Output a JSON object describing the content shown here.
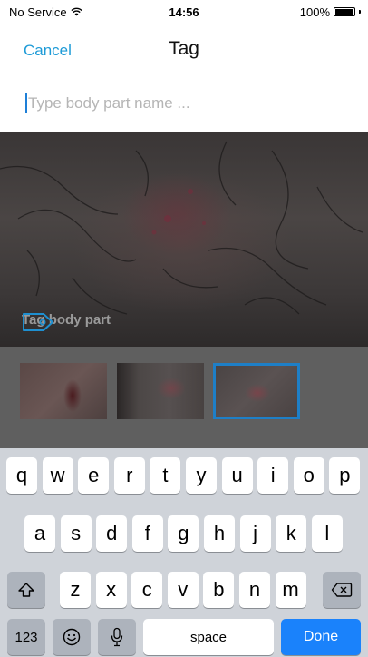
{
  "status_bar": {
    "carrier": "No Service",
    "time": "14:56",
    "battery_percent": "100%",
    "battery_level": 1.0
  },
  "nav": {
    "cancel_label": "Cancel",
    "title": "Tag"
  },
  "tag_input": {
    "placeholder": "Type body part name ...",
    "value": ""
  },
  "photo": {
    "tag_label": "Tag body part"
  },
  "thumbnails": {
    "count": 3,
    "selected_index": 2
  },
  "keyboard": {
    "row1": [
      "q",
      "w",
      "e",
      "r",
      "t",
      "y",
      "u",
      "i",
      "o",
      "p"
    ],
    "row2": [
      "a",
      "s",
      "d",
      "f",
      "g",
      "h",
      "j",
      "k",
      "l"
    ],
    "row3": [
      "z",
      "x",
      "c",
      "v",
      "b",
      "n",
      "m"
    ],
    "numbers_label": "123",
    "space_label": "space",
    "done_label": "Done"
  },
  "colors": {
    "accent": "#1e9bd7",
    "done_key": "#1a82fb",
    "selected_border": "#1e7fc7"
  }
}
